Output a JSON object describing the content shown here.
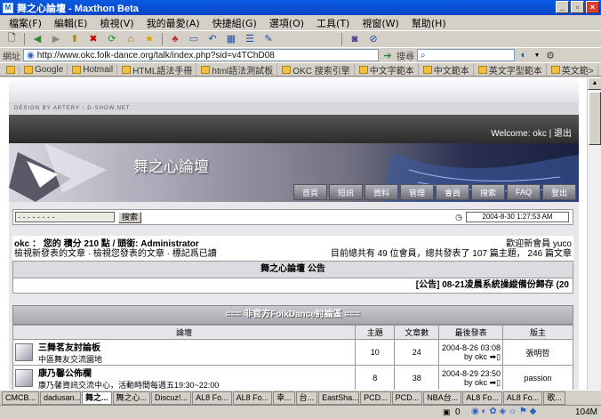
{
  "window": {
    "title": "舞之心論壇 - Maxthon Beta"
  },
  "menu": [
    "檔案(F)",
    "編輯(E)",
    "檢視(V)",
    "我的最愛(A)",
    "快捷組(G)",
    "選項(O)",
    "工具(T)",
    "視窗(W)",
    "幫助(H)"
  ],
  "address": {
    "label": "網址",
    "url": "http://www.okc.folk-dance.org/talk/index.php?sid=v4TChD08",
    "search_label": "搜尋"
  },
  "favorites": [
    "Google",
    "Hotmail",
    "HTML語法手冊",
    "html語法測試板",
    "OKC 搜索引擎",
    "中文字範本",
    "中文範本",
    "英文字型範本",
    "英文範>"
  ],
  "forum": {
    "design_credit": "DESIGN BY ARTERY - D-SHOW.NET",
    "welcome": "Welcome: okc | 退出",
    "banner_title": "舞之心論壇",
    "nav": [
      "首頁",
      "短訊",
      "資料",
      "管理",
      "會員",
      "搜索",
      "FAQ",
      "登出"
    ],
    "search_placeholder": "- - - - - - - -",
    "search_button": "搜索",
    "clock": "2004-8-30   1:27:53 AM",
    "user_line1": "okc ： 您的 積分 210 點 / 頭銜: Administrator",
    "user_line2": "檢視新發表的文章  ·  檢視您發表的文章  ·  標記爲已讀",
    "stats_line1": "歡迎新會員 yuco",
    "stats_line2": "目前總共有 49 位會員，總共發表了 107 篇主題， 246 篇文章",
    "announce_title": "舞之心論壇 公告",
    "announce_text": "[公告] 08-21凌晨系統操縱備份歸存 (20",
    "section_title": "=== 非官方FolkDance討論區 ===",
    "columns": [
      "論壇",
      "主題",
      "文章數",
      "最後發表",
      "版主"
    ],
    "rows": [
      {
        "name": "三舞茗友討論板",
        "desc": "中區舞友交流園地",
        "topics": "10",
        "posts": "24",
        "last_time": "2004-8-26 03:08",
        "last_by": "by okc",
        "moderator": "張明哲"
      },
      {
        "name": "康乃馨公佈欄",
        "desc": "康乃馨資訊交流中心，活動時間每週五19:30~22:00",
        "topics": "8",
        "posts": "38",
        "last_time": "2004-8-29 23:50",
        "last_by": "by okc",
        "moderator": "passion"
      }
    ]
  },
  "taskbar_tabs": [
    "CMCB...",
    "dadusan...",
    "舞之...",
    "舞之心...",
    "Discuz!...",
    "AL8 Fo...",
    "AL8 Fo...",
    "幸...",
    "台...",
    "EastSha...",
    "PCD...",
    "PCD...",
    "NBA台...",
    "AL8 Fo...",
    "AL8 Fo...",
    "歌..."
  ],
  "status": {
    "count": "0",
    "memory": "104M"
  }
}
